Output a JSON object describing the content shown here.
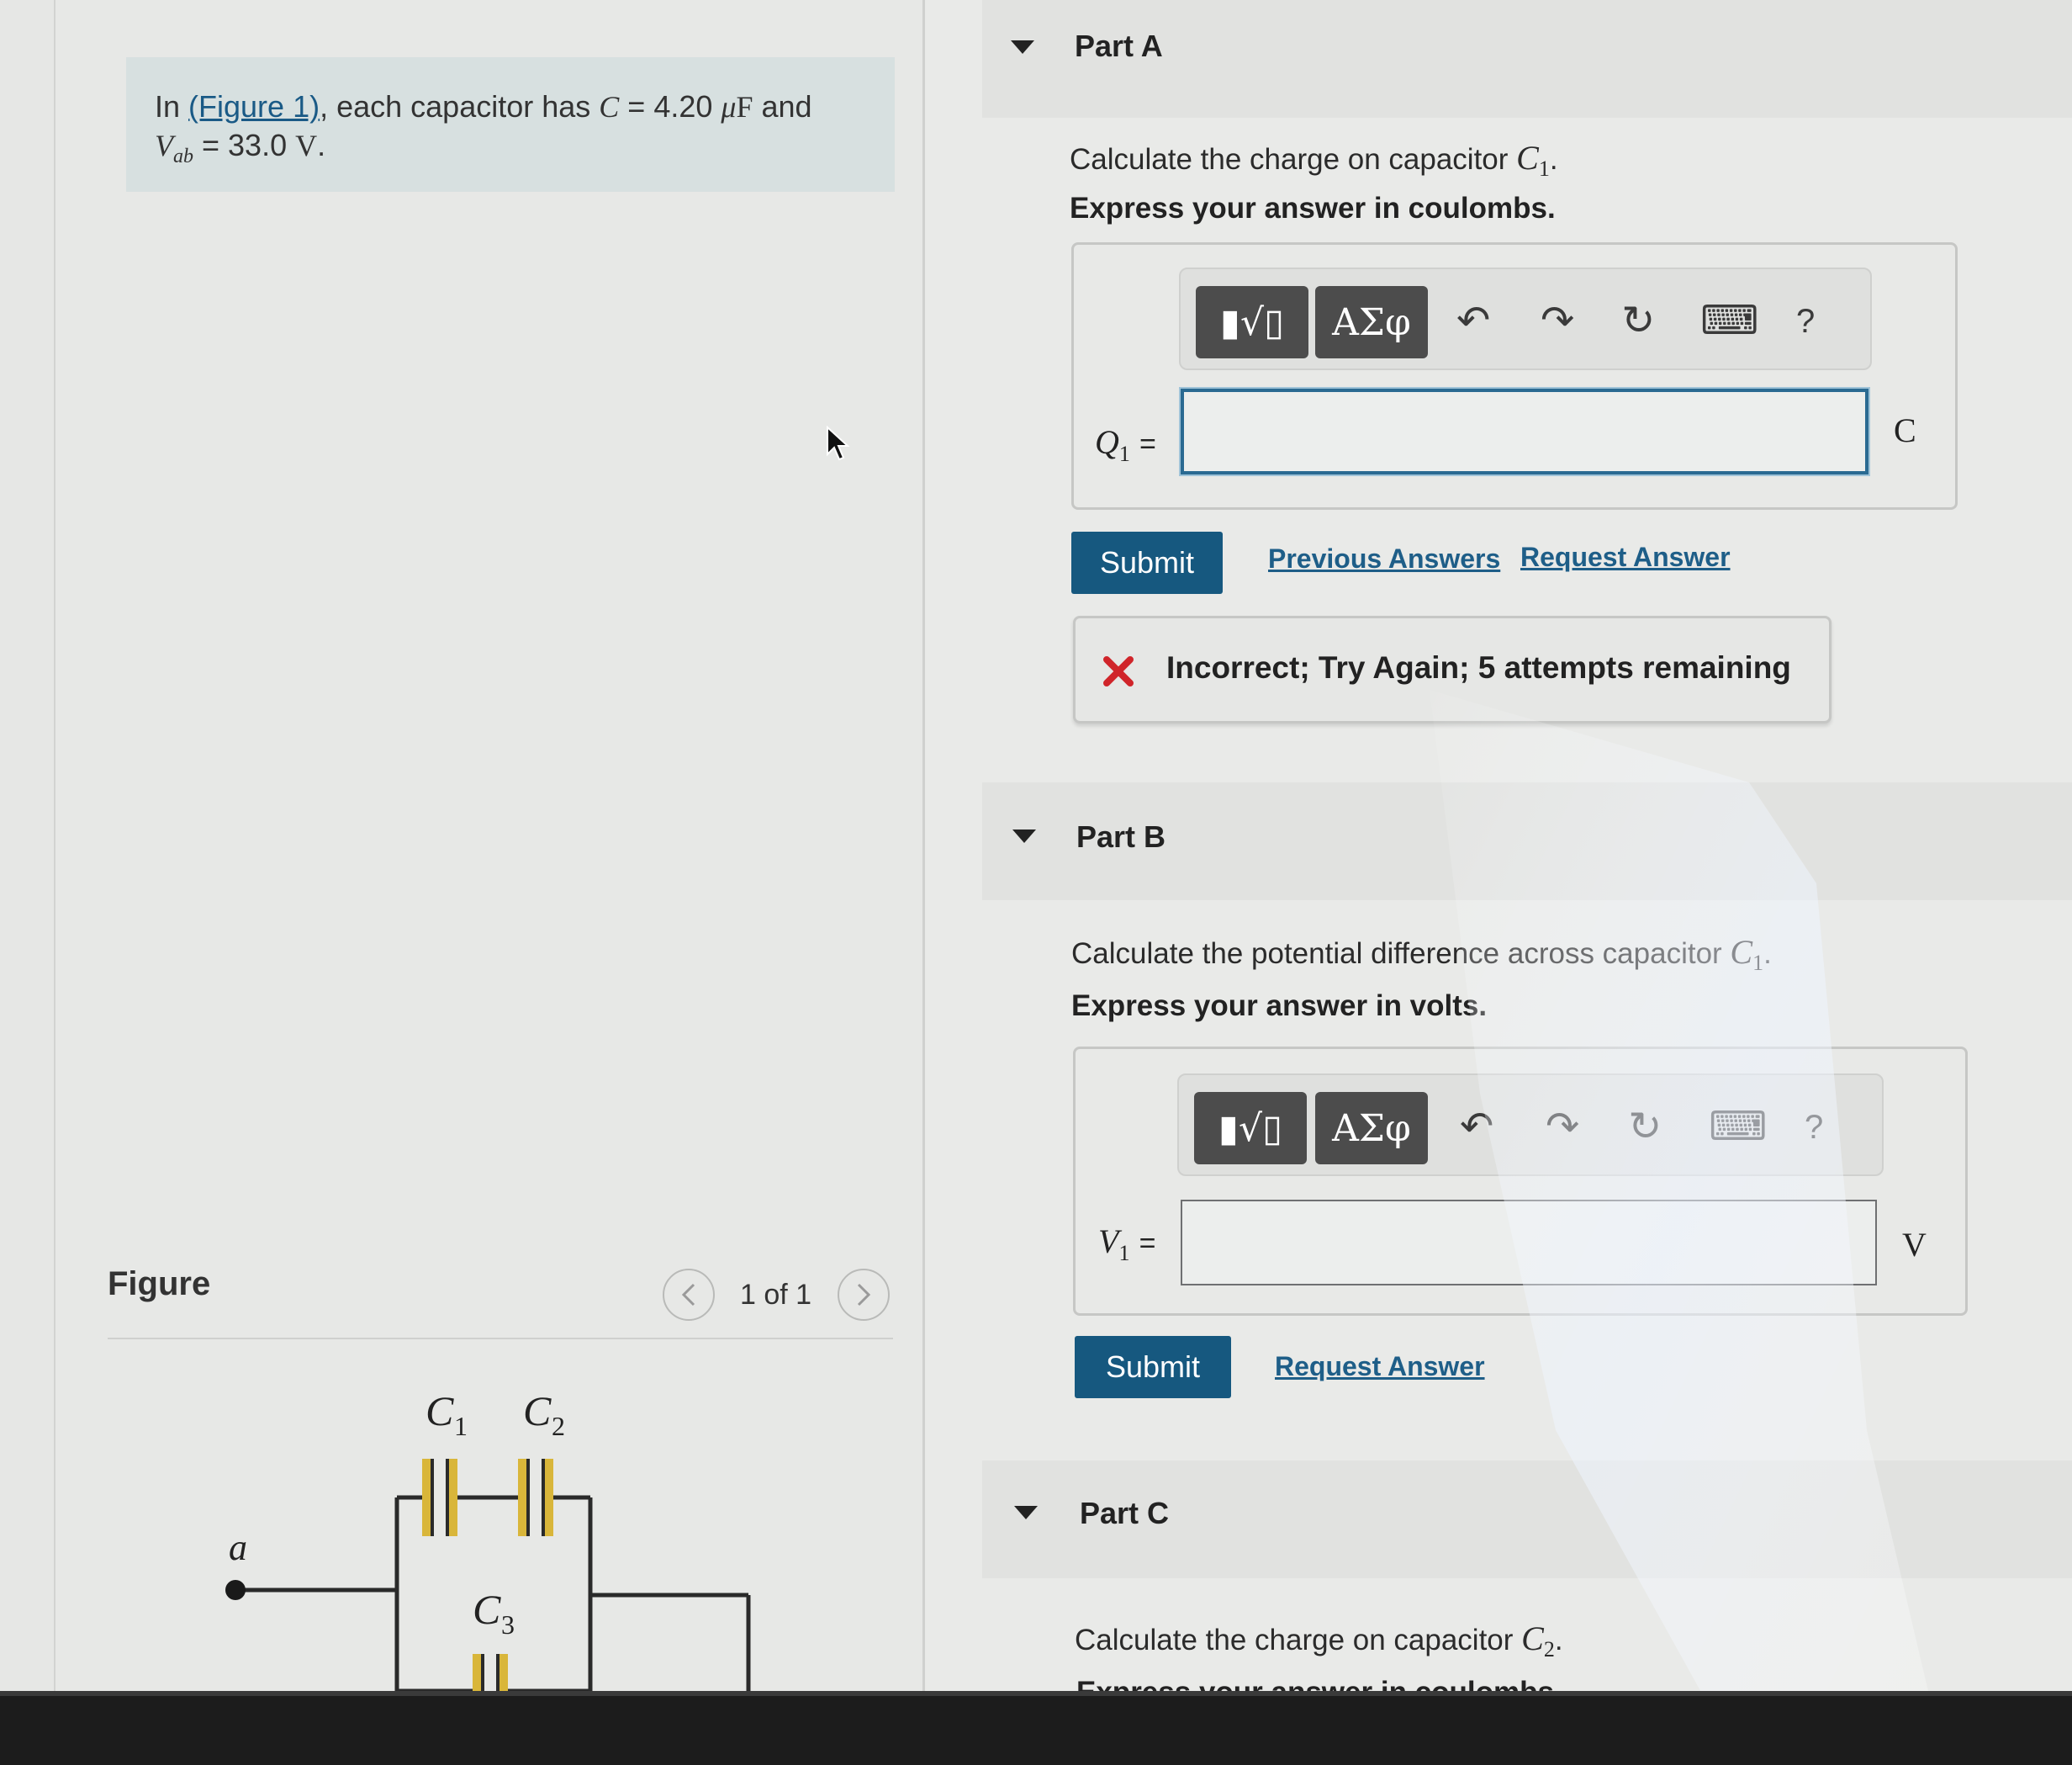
{
  "problem": {
    "text_prefix": "In ",
    "figure_link": "(Figure 1)",
    "text_middle": ", each capacitor has ",
    "c_var": "C",
    "c_eq": " = 4.20 ",
    "c_unit_mu": "μ",
    "c_unit_f": "F",
    "and": " and",
    "v_var": "V",
    "v_sub": "ab",
    "v_eq": " = 33.0 ",
    "v_unit": "V",
    "v_end": "."
  },
  "figure": {
    "title": "Figure",
    "counter": "1 of 1",
    "prev_icon": "chevron-left-icon",
    "next_icon": "chevron-right-icon",
    "labels": {
      "c1": "C",
      "c1_sub": "1",
      "c2": "C",
      "c2_sub": "2",
      "c3": "C",
      "c3_sub": "3",
      "node_a": "a"
    }
  },
  "toolbar": {
    "template_icon": "▮√▯",
    "greek_icon": "ΑΣφ",
    "undo_icon": "↶",
    "redo_icon": "↷",
    "reset_icon": "↻",
    "keyboard_icon": "⌨",
    "help_icon": "?"
  },
  "part_a": {
    "label": "Part A",
    "question": "Calculate the charge on capacitor ",
    "q_var": "C",
    "q_sub": "1",
    "instruction": "Express your answer in coulombs.",
    "var_label": "Q",
    "var_sub": "1",
    "equals": "=",
    "unit": "C",
    "input_value": "",
    "submit": "Submit",
    "previous_answers": "Previous Answers",
    "request_answer": "Request Answer",
    "feedback": "Incorrect; Try Again; 5 attempts remaining"
  },
  "part_b": {
    "label": "Part B",
    "question": "Calculate the potential difference across capacitor ",
    "q_var": "C",
    "q_sub": "1",
    "instruction": "Express your answer in volts.",
    "var_label": "V",
    "var_sub": "1",
    "equals": "=",
    "unit": "V",
    "input_value": "",
    "submit": "Submit",
    "request_answer": "Request Answer"
  },
  "part_c": {
    "label": "Part C",
    "question": "Calculate the charge on capacitor ",
    "q_var": "C",
    "q_sub": "2",
    "instruction": "Express your answer in coulombs."
  },
  "colors": {
    "accent": "#16587f",
    "link": "#1e5e88",
    "error": "#d0252a",
    "capacitor_plate": "#d9b63a"
  }
}
